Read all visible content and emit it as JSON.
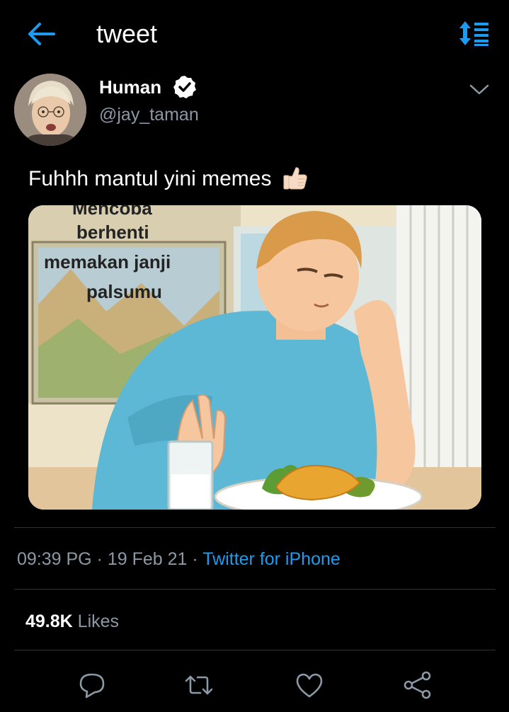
{
  "header": {
    "title": "tweet",
    "back_icon": "arrow-left-icon",
    "sort_icon": "sort-list-icon",
    "accent": "#1d9bf0"
  },
  "author": {
    "name": "Human",
    "handle": "@jay_taman",
    "verified_icon": "verified-badge-icon"
  },
  "tweet": {
    "text": "Fuhhh mantul yini memes",
    "emoji_icon": "thumbs-up-icon",
    "media": {
      "caption_lines": [
        "Mencoba",
        "berhenti",
        "memakan janji",
        "palsumu"
      ]
    }
  },
  "meta": {
    "time": "09:39 PG",
    "sep1": "·",
    "date": "19 Feb 21",
    "sep2": "·",
    "source": "Twitter for iPhone"
  },
  "stats": {
    "likes_count": "49.8K",
    "likes_label": "Likes"
  },
  "actions": [
    "reply-icon",
    "retweet-icon",
    "like-icon",
    "share-icon"
  ],
  "colors": {
    "background": "#000000",
    "text_primary": "#ffffff",
    "text_secondary": "#8b98a5",
    "link": "#1d9bf0",
    "divider": "#2f3336"
  }
}
